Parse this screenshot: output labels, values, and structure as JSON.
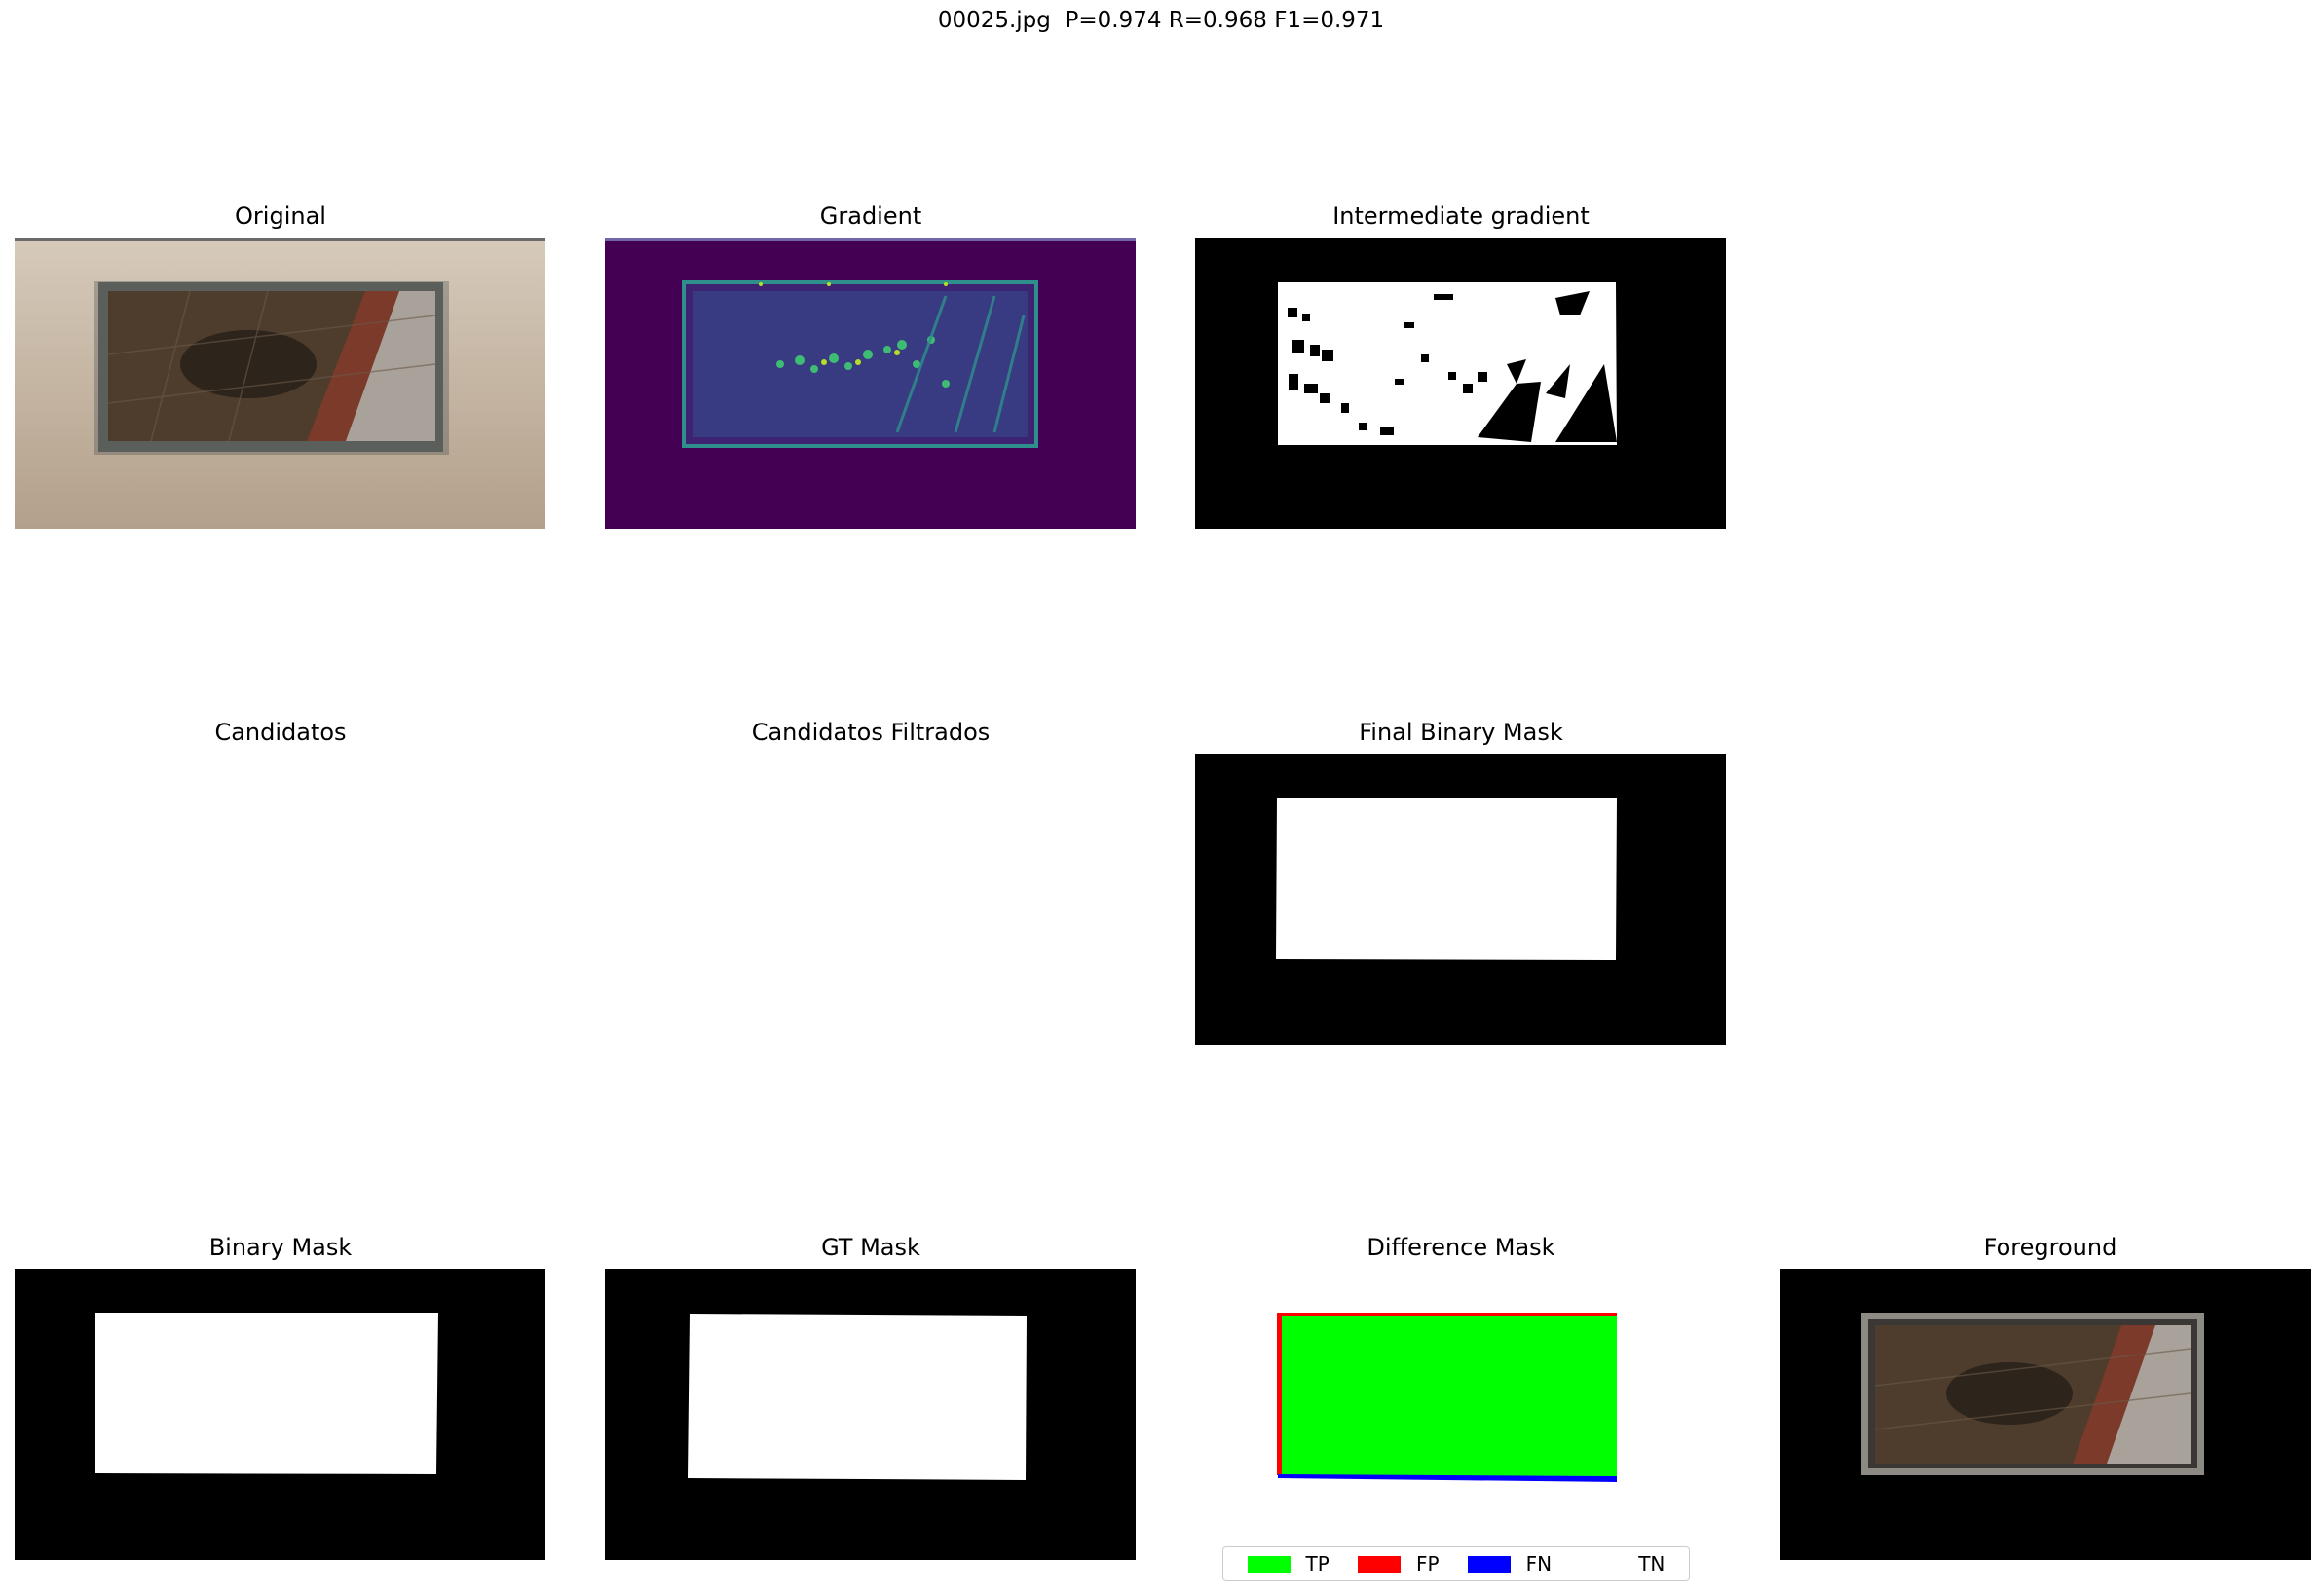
{
  "figure": {
    "suptitle": "00025.jpg  P=0.974 R=0.968 F1=0.971"
  },
  "panels": {
    "original": "Original",
    "gradient": "Gradient",
    "intermediate": "Intermediate gradient",
    "candidatos": "Candidatos",
    "candidatos_filtrados": "Candidatos Filtrados",
    "final_mask": "Final Binary Mask",
    "binary_mask": "Binary Mask",
    "gt_mask": "GT Mask",
    "difference": "Difference Mask",
    "foreground": "Foreground"
  },
  "metrics": {
    "precision": 0.974,
    "recall": 0.968,
    "f1": 0.971
  },
  "legend": [
    {
      "label": "TP",
      "color": "#00ff00"
    },
    {
      "label": "FP",
      "color": "#ff0000"
    },
    {
      "label": "FN",
      "color": "#0000ff"
    },
    {
      "label": "TN",
      "color": "#ffffff"
    }
  ],
  "colors": {
    "mask_bg": "#000000",
    "mask_fg": "#ffffff",
    "gradient_bg": "#440154",
    "wall": "#cbbba7"
  }
}
